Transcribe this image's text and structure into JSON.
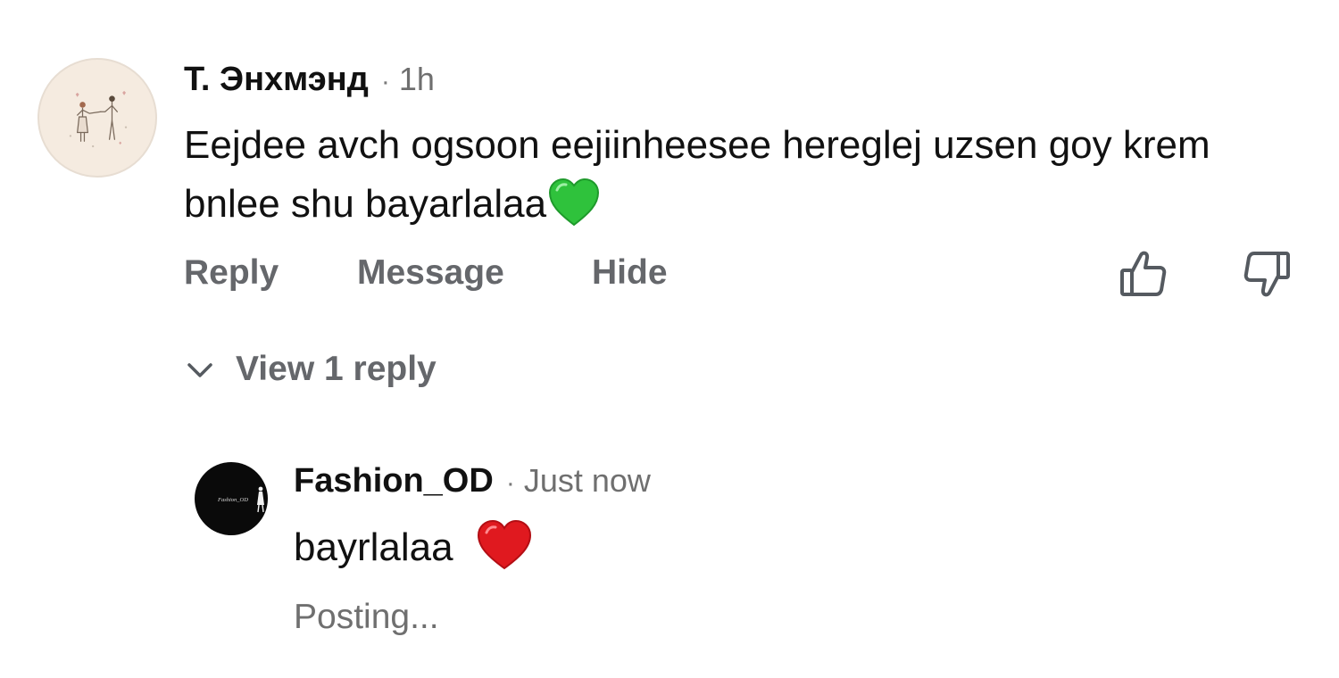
{
  "comment": {
    "author": "Т. Энхмэнд",
    "separator": "·",
    "time": "1h",
    "text": "Eejdee avch ogsoon eejiinheesee hereglej uzsen goy krem bnlee shu bayarlalaa",
    "emoji": "green-heart-emoji",
    "avatar": "couple-illustration-avatar",
    "actions": {
      "reply": "Reply",
      "message": "Message",
      "hide": "Hide"
    },
    "icons": {
      "like": "thumbs-up-icon",
      "dislike": "thumbs-down-icon"
    }
  },
  "replies_toggle": {
    "label": "View 1 reply",
    "icon": "chevron-down-icon"
  },
  "reply": {
    "author": "Fashion_OD",
    "separator": "·",
    "time": "Just now",
    "text": "bayrlalaa",
    "emoji": "red-heart-emoji",
    "avatar_label": "Fashion_OD",
    "status": "Posting..."
  },
  "colors": {
    "text_primary": "#111111",
    "text_secondary": "#65676b",
    "timestamp": "#6f6f6f",
    "avatar_main_bg": "#f5ebe0",
    "avatar_reply_bg": "#0a0a0a",
    "green_heart": "#2ecc40",
    "red_heart": "#e0191f"
  }
}
